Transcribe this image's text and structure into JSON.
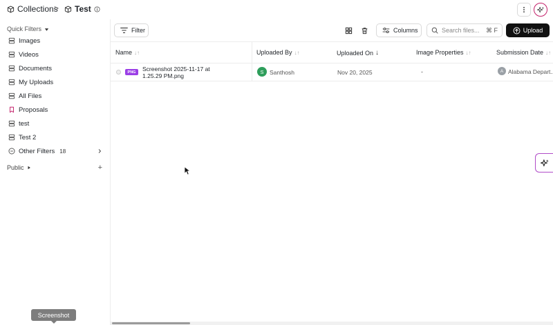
{
  "breadcrumb": {
    "root": "Collections",
    "separator": ">",
    "current": "Test"
  },
  "sidebar": {
    "quick_filters_label": "Quick Filters",
    "items": [
      {
        "label": "Images"
      },
      {
        "label": "Videos"
      },
      {
        "label": "Documents"
      },
      {
        "label": "My Uploads"
      },
      {
        "label": "All Files"
      },
      {
        "label": "Proposals"
      },
      {
        "label": "test"
      },
      {
        "label": "Test 2"
      },
      {
        "label": "Other Filters",
        "count": "18"
      }
    ],
    "public_label": "Public",
    "add_symbol": "+"
  },
  "toolbar": {
    "filter_label": "Filter",
    "columns_label": "Columns",
    "search_placeholder": "Search files...",
    "search_shortcut": "⌘ F",
    "upload_label": "Upload"
  },
  "table": {
    "headers": [
      "Name",
      "Uploaded By",
      "Uploaded On",
      "Image Properties",
      "Submission Date"
    ],
    "rows": [
      {
        "type_badge": "PNG",
        "name": "Screenshot 2025-11-17 at 1.25.29 PM.png",
        "uploader_initial": "S",
        "uploader": "Santhosh",
        "uploaded_on": "Nov 20, 2025",
        "image_properties": "-",
        "org_initial": "A",
        "org": "Alabama Depart..."
      }
    ]
  },
  "tooltip": "Screenshot",
  "colors": {
    "accent": "#c3206a",
    "png_badge": "#9b3fe6",
    "avatar_green": "#2e9e5b",
    "upload_bg": "#111111"
  }
}
